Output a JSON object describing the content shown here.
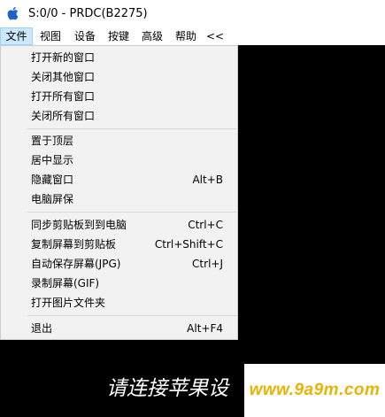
{
  "window": {
    "title": "S:0/0 - PRDC(B2275)",
    "icon": "apple-icon"
  },
  "menubar": {
    "items": [
      {
        "label": "文件"
      },
      {
        "label": "视图"
      },
      {
        "label": "设备"
      },
      {
        "label": "按键"
      },
      {
        "label": "高级"
      },
      {
        "label": "帮助"
      },
      {
        "label": "<<"
      }
    ]
  },
  "file_menu": {
    "items": [
      {
        "label": "打开新的窗口",
        "shortcut": ""
      },
      {
        "label": "关闭其他窗口",
        "shortcut": ""
      },
      {
        "label": "打开所有窗口",
        "shortcut": ""
      },
      {
        "label": "关闭所有窗口",
        "shortcut": ""
      },
      {
        "label": "置于顶层",
        "shortcut": ""
      },
      {
        "label": "居中显示",
        "shortcut": ""
      },
      {
        "label": "隐藏窗口",
        "shortcut": "Alt+B"
      },
      {
        "label": "电脑屏保",
        "shortcut": ""
      },
      {
        "label": "同步剪贴板到到电脑",
        "shortcut": "Ctrl+C"
      },
      {
        "label": "复制屏幕到剪贴板",
        "shortcut": "Ctrl+Shift+C"
      },
      {
        "label": "自动保存屏幕(JPG)",
        "shortcut": "Ctrl+J"
      },
      {
        "label": "录制屏幕(GIF)",
        "shortcut": ""
      },
      {
        "label": "打开图片文件夹",
        "shortcut": ""
      },
      {
        "label": "退出",
        "shortcut": "Alt+F4"
      }
    ]
  },
  "screen": {
    "message": "请连接苹果设",
    "background": "#000000"
  },
  "watermark": {
    "text": "www.9a9m.com",
    "color": "#e8b400"
  }
}
